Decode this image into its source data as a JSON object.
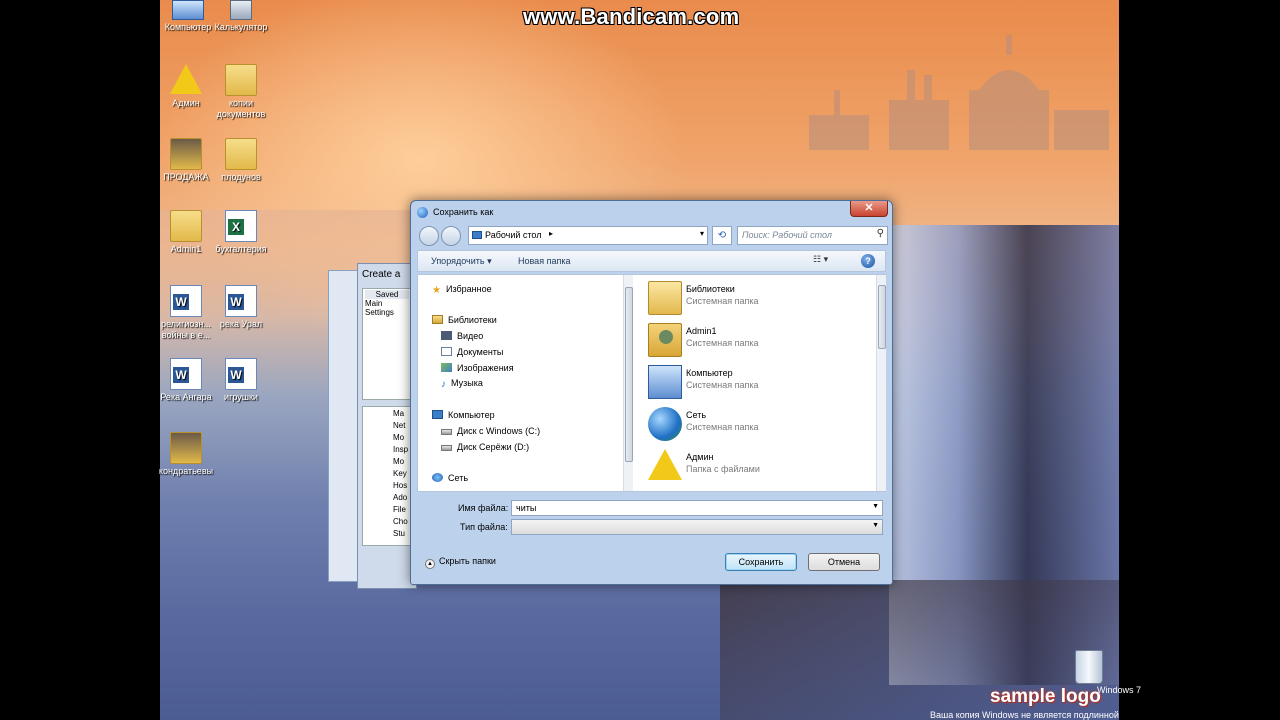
{
  "watermark": "www.Bandicam.com",
  "desktop_icons": [
    {
      "label": "Компьютер",
      "type": "pc"
    },
    {
      "label": "Калькулятор",
      "type": "calc"
    },
    {
      "label": "Админ",
      "type": "warn"
    },
    {
      "label": "копии документов",
      "type": "folder"
    },
    {
      "label": "ПРОДАЖА",
      "type": "folder"
    },
    {
      "label": "плодунов",
      "type": "folder"
    },
    {
      "label": "Admin1",
      "type": "folder"
    },
    {
      "label": "бухгалтерия",
      "type": "xls"
    },
    {
      "label": "религиозн... войны в е...",
      "type": "doc"
    },
    {
      "label": "река Урал",
      "type": "doc"
    },
    {
      "label": "Река Ангара",
      "type": "doc"
    },
    {
      "label": "игрушки",
      "type": "doc"
    },
    {
      "label": "кондратьевы",
      "type": "folder"
    }
  ],
  "back_window": {
    "title": "Create a",
    "tab": "Saved",
    "items": [
      "Main",
      "Settings"
    ],
    "tree": [
      "Ma",
      "Net",
      "Mo",
      "Insp",
      "Mo",
      "Key",
      "Hos",
      "Ado",
      "File",
      "Cho",
      "Stu"
    ]
  },
  "dialog": {
    "title": "Сохранить как",
    "close": "✕",
    "address": "Рабочий стол",
    "search_placeholder": "Поиск: Рабочий стол",
    "toolbar": {
      "organize": "Упорядочить",
      "new_folder": "Новая папка"
    },
    "nav": {
      "favorites": "Избранное",
      "libraries": "Библиотеки",
      "video": "Видео",
      "documents": "Документы",
      "images": "Изображения",
      "music": "Музыка",
      "computer": "Компьютер",
      "disk_c": "Диск с Windows (C:)",
      "disk_d": "Диск Серёжи (D:)",
      "network": "Сеть"
    },
    "files": [
      {
        "name": "Библиотеки",
        "type": "Системная папка",
        "icon": "library-icon"
      },
      {
        "name": "Admin1",
        "type": "Системная папка",
        "icon": "user-folder-icon"
      },
      {
        "name": "Компьютер",
        "type": "Системная папка",
        "icon": "computer-icon"
      },
      {
        "name": "Сеть",
        "type": "Системная папка",
        "icon": "network-icon"
      },
      {
        "name": "Админ",
        "type": "Папка с файлами",
        "icon": "warning-icon"
      }
    ],
    "filename_label": "Имя файла:",
    "filename_value": "читы",
    "filetype_label": "Тип файла:",
    "filetype_value": "",
    "hide_folders": "Скрыть папки",
    "save_button": "Сохранить",
    "cancel_button": "Отмена"
  },
  "overlay": {
    "sample_logo": "sample logo",
    "windows_notice": "Ваша копия Windows не является подлинной",
    "windows_version": "Windows 7"
  }
}
